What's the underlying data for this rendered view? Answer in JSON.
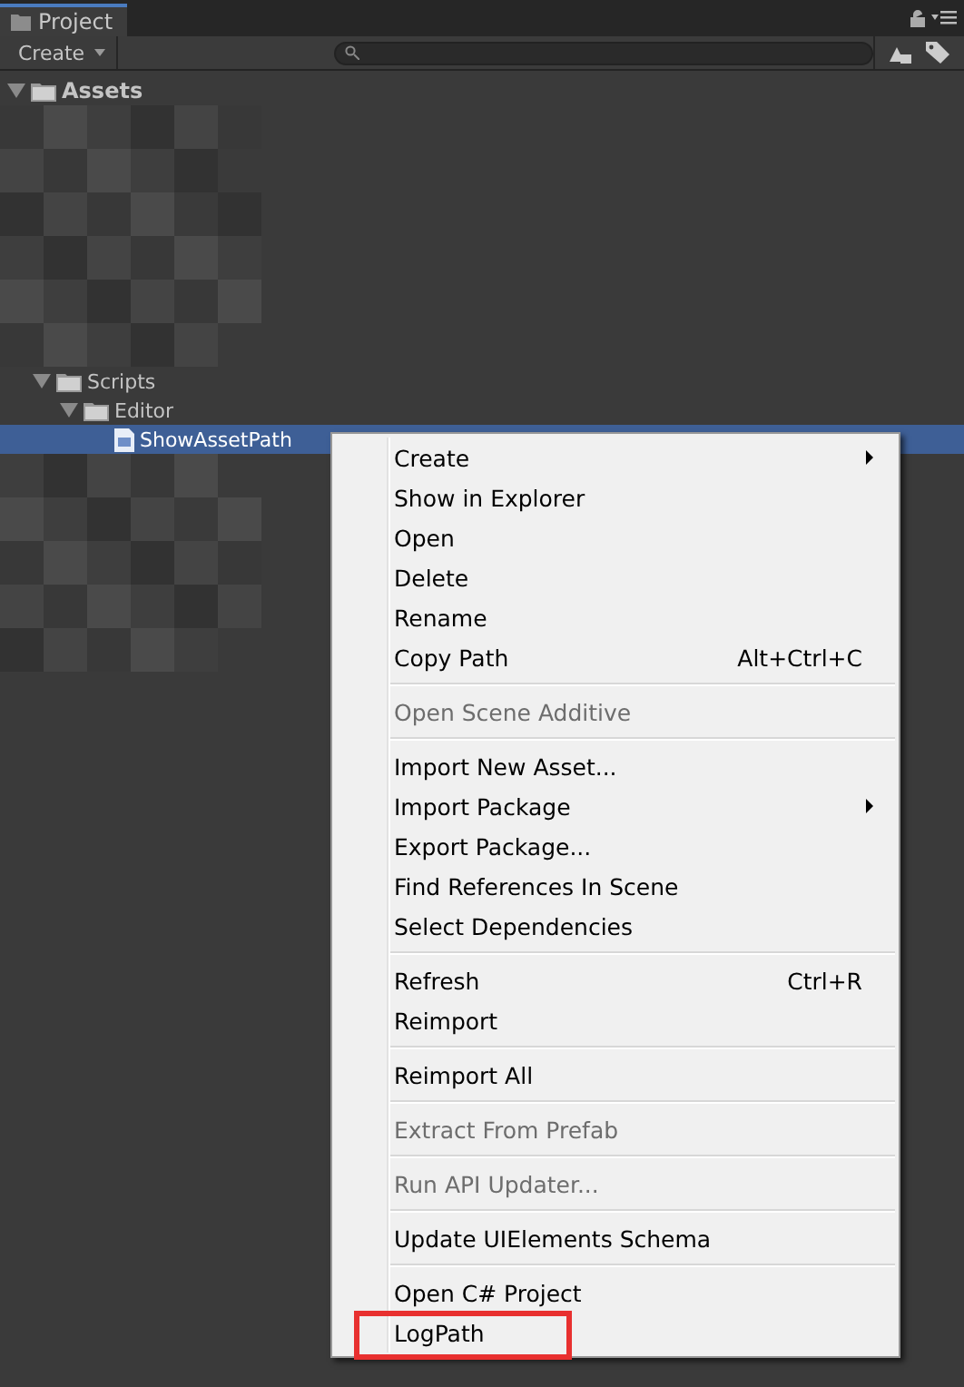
{
  "tab": {
    "label": "Project",
    "selected": true
  },
  "toolbar": {
    "create_label": "Create"
  },
  "tree": [
    {
      "label": "Assets",
      "kind": "folder",
      "expanded": true,
      "selected": false,
      "children": [
        {
          "label": "Scripts",
          "kind": "folder",
          "expanded": true,
          "selected": false,
          "children": [
            {
              "label": "Editor",
              "kind": "folder",
              "expanded": true,
              "selected": false,
              "children": [
                {
                  "label": "ShowAssetPath",
                  "kind": "file",
                  "selected": true
                }
              ]
            }
          ]
        }
      ]
    }
  ],
  "context_menu": {
    "groups": [
      {
        "items": [
          {
            "label": "Create",
            "disabled": false,
            "submenu": true,
            "outlined": false
          },
          {
            "label": "Show in Explorer",
            "disabled": false,
            "submenu": false,
            "outlined": false
          },
          {
            "label": "Open",
            "disabled": false,
            "submenu": false,
            "outlined": false
          },
          {
            "label": "Delete",
            "disabled": false,
            "submenu": false,
            "outlined": false
          },
          {
            "label": "Rename",
            "disabled": false,
            "submenu": false,
            "outlined": false
          },
          {
            "label": "Copy Path",
            "shortcut": "Alt+Ctrl+C",
            "disabled": false,
            "submenu": false,
            "outlined": false
          }
        ]
      },
      {
        "items": [
          {
            "label": "Open Scene Additive",
            "disabled": true,
            "submenu": false,
            "outlined": false
          }
        ]
      },
      {
        "items": [
          {
            "label": "Import New Asset...",
            "disabled": false,
            "submenu": false,
            "outlined": false
          },
          {
            "label": "Import Package",
            "disabled": false,
            "submenu": true,
            "outlined": false
          },
          {
            "label": "Export Package...",
            "disabled": false,
            "submenu": false,
            "outlined": false
          },
          {
            "label": "Find References In Scene",
            "disabled": false,
            "submenu": false,
            "outlined": false
          },
          {
            "label": "Select Dependencies",
            "disabled": false,
            "submenu": false,
            "outlined": false
          }
        ]
      },
      {
        "items": [
          {
            "label": "Refresh",
            "shortcut": "Ctrl+R",
            "disabled": false,
            "submenu": false,
            "outlined": false
          },
          {
            "label": "Reimport",
            "disabled": false,
            "submenu": false,
            "outlined": false
          }
        ]
      },
      {
        "items": [
          {
            "label": "Reimport All",
            "disabled": false,
            "submenu": false,
            "outlined": false
          }
        ]
      },
      {
        "items": [
          {
            "label": "Extract From Prefab",
            "disabled": true,
            "submenu": false,
            "outlined": false
          }
        ]
      },
      {
        "items": [
          {
            "label": "Run API Updater...",
            "disabled": true,
            "submenu": false,
            "outlined": false
          }
        ]
      },
      {
        "items": [
          {
            "label": "Update UIElements Schema",
            "disabled": false,
            "submenu": false,
            "outlined": false
          }
        ]
      },
      {
        "items": [
          {
            "label": "Open C# Project",
            "disabled": false,
            "submenu": false,
            "outlined": false
          },
          {
            "label": "LogPath",
            "disabled": false,
            "submenu": false,
            "outlined": true
          }
        ]
      }
    ]
  }
}
